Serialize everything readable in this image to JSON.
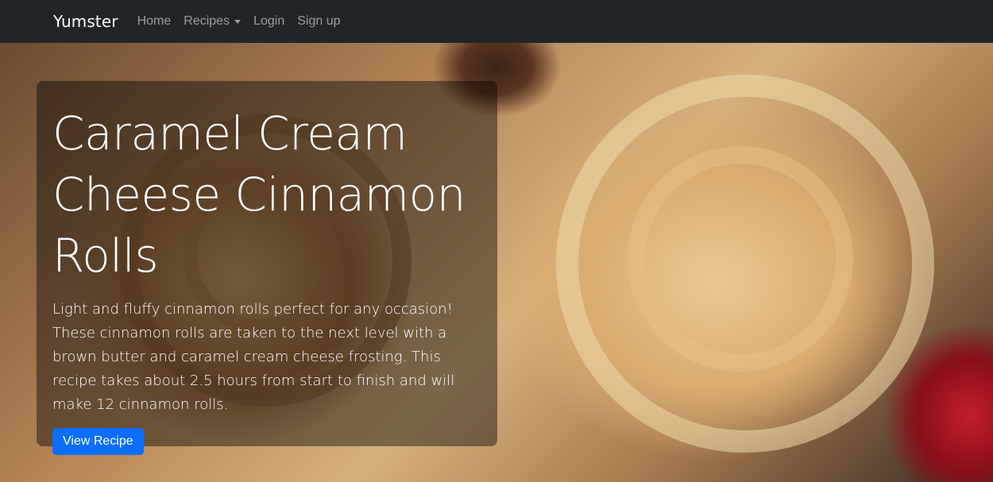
{
  "navbar": {
    "brand": "Yumster",
    "links": [
      {
        "label": "Home"
      },
      {
        "label": "Recipes",
        "dropdown": true
      },
      {
        "label": "Login"
      },
      {
        "label": "Sign up"
      }
    ]
  },
  "hero": {
    "title": "Caramel Cream Cheese Cinnamon Rolls",
    "description": "Light and fluffy cinnamon rolls perfect for any occasion! These cinnamon rolls are taken to the next level with a brown butter and caramel cream cheese frosting. This recipe takes about 2.5 hours from start to finish and will make 12 cinnamon rolls.",
    "button_label": "View Recipe"
  },
  "colors": {
    "navbar_bg": "#212529",
    "button_bg": "#0d6efd"
  },
  "icons": {
    "recipes_dropdown": "caret-down-icon"
  }
}
